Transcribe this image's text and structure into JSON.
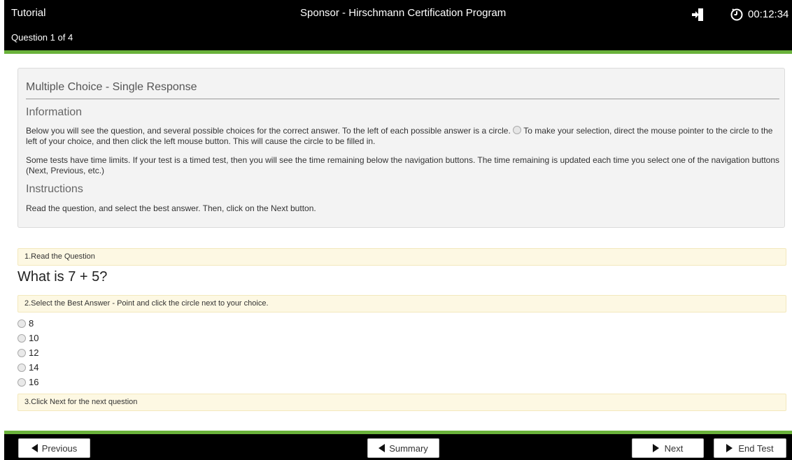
{
  "header": {
    "tutorial_label": "Tutorial",
    "program_title": "Sponsor - Hirschmann Certification Program",
    "question_counter": "Question 1 of 4",
    "timer": "00:12:34"
  },
  "info": {
    "panel_title": "Multiple Choice - Single Response",
    "information_heading": "Information",
    "para1_before": "Below you will see the question, and several possible choices for the correct answer. To the left of each possible answer is a circle.",
    "para1_after": " To make your selection, direct the mouse pointer to the circle to the left of your choice, and then click the left mouse button. This will cause the circle to be filled in.",
    "para2": "Some tests have time limits. If your test is a timed test, then you will see the time remaining below the navigation buttons. The time remaining is updated each time you select one of the navigation buttons (Next, Previous, etc.)",
    "instructions_heading": "Instructions",
    "instructions_text": "Read the question, and select the best answer. Then, click on the Next button."
  },
  "steps": {
    "step1": "1.Read the Question",
    "step2": "2.Select the Best Answer - Point and click the circle next to your choice.",
    "step3": "3.Click Next for the next question"
  },
  "question": {
    "text": "What is 7 + 5?",
    "options": [
      "8",
      "10",
      "12",
      "14",
      "16"
    ]
  },
  "footer": {
    "previous_label": "Previous",
    "summary_label": "Summary",
    "next_label": "Next",
    "end_test_label": "End Test"
  },
  "colors": {
    "header_bg": "#000000",
    "accent_green": "#6ab23b",
    "step_bg": "#fdf8e3",
    "panel_bg": "#f3f3f3"
  }
}
